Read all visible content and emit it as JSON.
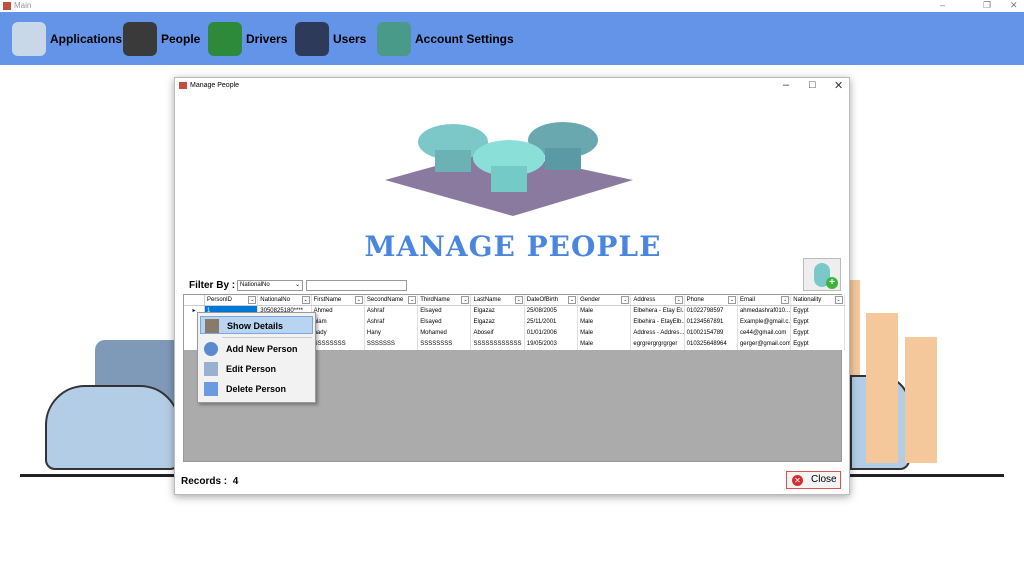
{
  "window": {
    "title": "Main"
  },
  "topnav": [
    {
      "label": "Applications",
      "icon": "applications-icon"
    },
    {
      "label": "People",
      "icon": "people-icon"
    },
    {
      "label": "Drivers",
      "icon": "drivers-icon"
    },
    {
      "label": "Users",
      "icon": "users-icon"
    },
    {
      "label": "Account Settings",
      "icon": "account-settings-icon"
    }
  ],
  "dialog": {
    "title": "Manage People",
    "heading": "MANAGE PEOPLE",
    "filter_label": "Filter By :",
    "filter_value": "NationalNo",
    "filter_text": "",
    "records_label": "Records :",
    "records_count": "4",
    "close_label": "Close"
  },
  "grid": {
    "columns": [
      "PersonID",
      "NationalNo",
      "FirstName",
      "SecondName",
      "ThirdName",
      "LastName",
      "DateOfBirth",
      "Gender",
      "Address",
      "Phone",
      "Email",
      "Nationality"
    ],
    "rows": [
      [
        "1",
        "3050825180****",
        "Ahmed",
        "Ashraf",
        "Elsayed",
        "Elgazaz",
        "25/08/2005",
        "Male",
        "Elbehera - Etay El...",
        "01022798597",
        "ahmedashraf010...",
        "Egypt"
      ],
      [
        "",
        "",
        "alam",
        "Ashraf",
        "Elsayed",
        "Elgazaz",
        "25/11/2001",
        "Male",
        "Elbehira - EtayElb...",
        "01234567891",
        "Example@gmail.c...",
        "Egypt"
      ],
      [
        "",
        "",
        "hady",
        "Hany",
        "Mohamed",
        "Aboseif",
        "01/01/2006",
        "Male",
        "Address - Addres...",
        "01002154789",
        "ce44@gmail.com",
        "Egypt"
      ],
      [
        "",
        "",
        "SSSSSSSS",
        "SSSSSSS",
        "SSSSSSSS",
        "SSSSSSSSSSSS",
        "19/05/2003",
        "Male",
        "egrgrergrgrgrger",
        "010325648964",
        "gerger@gmail.com",
        "Egypt"
      ]
    ]
  },
  "context_menu": [
    "Show Details",
    "Add New Person",
    "Edit Person",
    "Delete Person"
  ],
  "colors": {
    "topbar": "#6394e8",
    "heading": "#4a86e0",
    "selection": "#0078d7"
  }
}
